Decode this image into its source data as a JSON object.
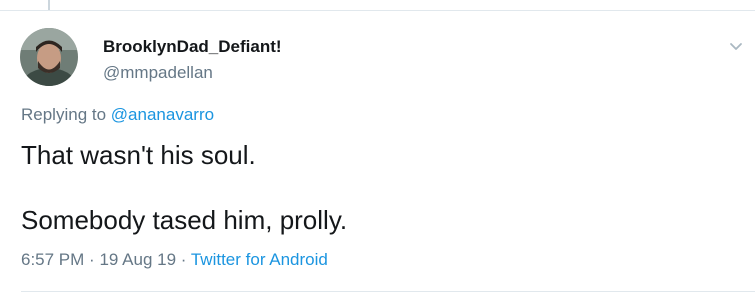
{
  "tweet": {
    "display_name": "BrooklynDad_Defiant!",
    "handle": "@mmpadellan",
    "replying_prefix": "Replying to",
    "replying_to": "@ananavarro",
    "text_line1": "That wasn't his soul.",
    "text_line2": "Somebody tased him, prolly.",
    "time": "6:57 PM",
    "separator": "·",
    "date": "19 Aug 19",
    "source": "Twitter for Android"
  },
  "icons": {
    "menu": "chevron-down-icon",
    "avatar": "user-avatar"
  },
  "colors": {
    "text": "#14171a",
    "secondary": "#657786",
    "link": "#1b95e0",
    "border": "#e1e8ed"
  }
}
